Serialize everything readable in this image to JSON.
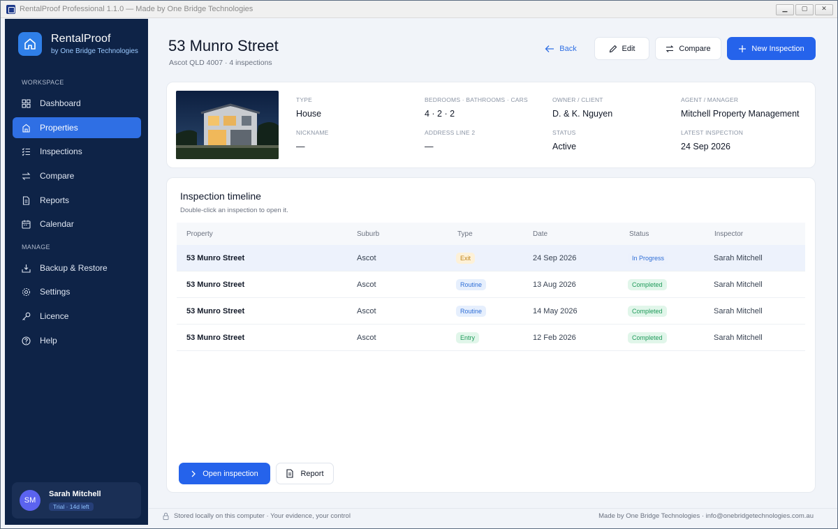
{
  "window": {
    "title": "RentalProof Professional 1.1.0 — Made by One Bridge Technologies",
    "buttons": [
      "▁",
      "▢",
      "✕"
    ]
  },
  "brand": {
    "name": "RentalProof",
    "sub": "by One Bridge Technologies"
  },
  "sidebar": {
    "workspace_label": "WORKSPACE",
    "manage_label": "MANAGE",
    "workspace_items": [
      {
        "label": "Dashboard",
        "icon": "grid-icon"
      },
      {
        "label": "Properties",
        "icon": "building-icon",
        "active": true
      },
      {
        "label": "Inspections",
        "icon": "checklist-icon"
      },
      {
        "label": "Compare",
        "icon": "swap-icon"
      },
      {
        "label": "Reports",
        "icon": "document-icon"
      },
      {
        "label": "Calendar",
        "icon": "calendar-icon"
      }
    ],
    "manage_items": [
      {
        "label": "Backup & Restore",
        "icon": "backup-icon"
      },
      {
        "label": "Settings",
        "icon": "gear-icon"
      },
      {
        "label": "Licence",
        "icon": "key-icon"
      },
      {
        "label": "Help",
        "icon": "help-icon"
      }
    ],
    "user": {
      "initials": "SM",
      "name": "Sarah Mitchell",
      "trial": "Trial · 14d left"
    }
  },
  "header": {
    "title": "53 Munro Street",
    "subtitle": "Ascot QLD 4007  ·  4 inspections",
    "back_label": "Back",
    "edit_label": "Edit",
    "compare_label": "Compare",
    "new_label": "New Inspection"
  },
  "property": {
    "type_label": "TYPE",
    "type_value": "House",
    "rooms_label": "BEDROOMS · BATHROOMS · CARS",
    "rooms_value": "4 · 2 · 2",
    "owner_label": "OWNER / CLIENT",
    "owner_value": "D. & K. Nguyen",
    "agent_label": "AGENT / MANAGER",
    "agent_value": "Mitchell Property Management",
    "nickname_label": "NICKNAME",
    "nickname_value": "—",
    "address2_label": "ADDRESS LINE 2",
    "address2_value": "—",
    "status_label": "STATUS",
    "status_value": "Active",
    "latest_label": "LATEST INSPECTION",
    "latest_value": "24 Sep 2026"
  },
  "timeline": {
    "title": "Inspection timeline",
    "subtitle": "Double-click an inspection to open it.",
    "columns": [
      "Property",
      "Suburb",
      "Type",
      "Date",
      "Status",
      "Inspector"
    ],
    "rows": [
      {
        "property": "53 Munro Street",
        "suburb": "Ascot",
        "type": "Exit",
        "date": "24 Sep 2026",
        "status": "In Progress",
        "inspector": "Sarah Mitchell"
      },
      {
        "property": "53 Munro Street",
        "suburb": "Ascot",
        "type": "Routine",
        "date": "13 Aug 2026",
        "status": "Completed",
        "inspector": "Sarah Mitchell"
      },
      {
        "property": "53 Munro Street",
        "suburb": "Ascot",
        "type": "Routine",
        "date": "14 May 2026",
        "status": "Completed",
        "inspector": "Sarah Mitchell"
      },
      {
        "property": "53 Munro Street",
        "suburb": "Ascot",
        "type": "Entry",
        "date": "12 Feb 2026",
        "status": "Completed",
        "inspector": "Sarah Mitchell"
      }
    ],
    "open_label": "Open inspection",
    "report_label": "Report"
  },
  "footer": {
    "left": "Stored locally on this computer  ·  Your evidence, your control",
    "right": "Made by One Bridge Technologies  ·  info@onebridgetechnologies.com.au"
  },
  "colors": {
    "sidebar": "#0e2347",
    "accent": "#2563eb",
    "active_nav": "#2f6fe4"
  }
}
